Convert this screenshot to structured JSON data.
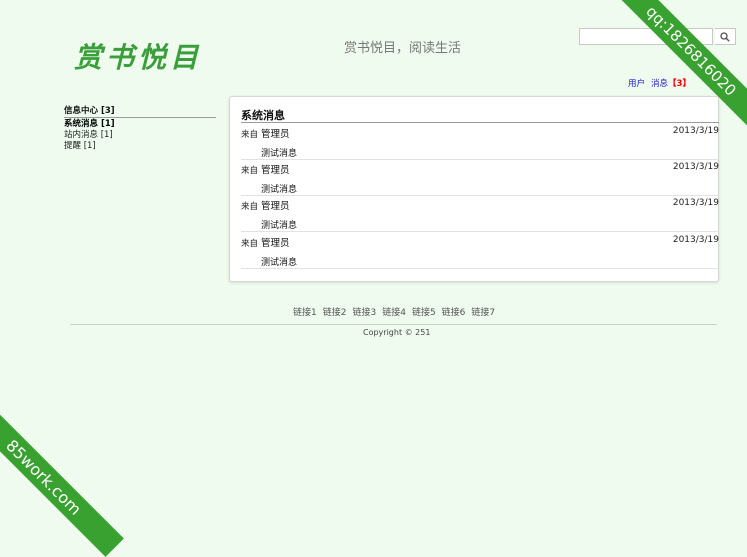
{
  "header": {
    "logo_text": "赏书悦目",
    "slogan": "赏书悦目，阅读生活",
    "search": {
      "value": "",
      "placeholder": ""
    }
  },
  "topnav": {
    "user_label": "用户",
    "messages_label": "消息",
    "messages_badge": "【3】"
  },
  "sidebar": {
    "heading": "信息中心 [3]",
    "items": [
      {
        "label": "系统消息 [1]"
      },
      {
        "label": "站内消息 [1]"
      },
      {
        "label": "提醒 [1]"
      }
    ]
  },
  "panel": {
    "title": "系统消息",
    "messages": [
      {
        "from_label": "来自",
        "sender": "管理员",
        "date": "2013/3/19",
        "content": "测试消息"
      },
      {
        "from_label": "来自",
        "sender": "管理员",
        "date": "2013/3/19",
        "content": "测试消息"
      },
      {
        "from_label": "来自",
        "sender": "管理员",
        "date": "2013/3/19",
        "content": "测试消息"
      },
      {
        "from_label": "来自",
        "sender": "管理员",
        "date": "2013/3/19",
        "content": "测试消息"
      }
    ]
  },
  "footer": {
    "links": [
      "链接1",
      "链接2",
      "链接3",
      "链接4",
      "链接5",
      "链接6",
      "链接7"
    ],
    "copyright": "Copyright © 251"
  },
  "watermarks": {
    "top_right": "qq:1826816020",
    "bottom_left": "85work.com"
  },
  "colors": {
    "background": "#effbef",
    "accent": "#39a12f",
    "link": "#2323c8",
    "badge": "#e00000"
  },
  "icons": {
    "search_button": "search-icon"
  }
}
